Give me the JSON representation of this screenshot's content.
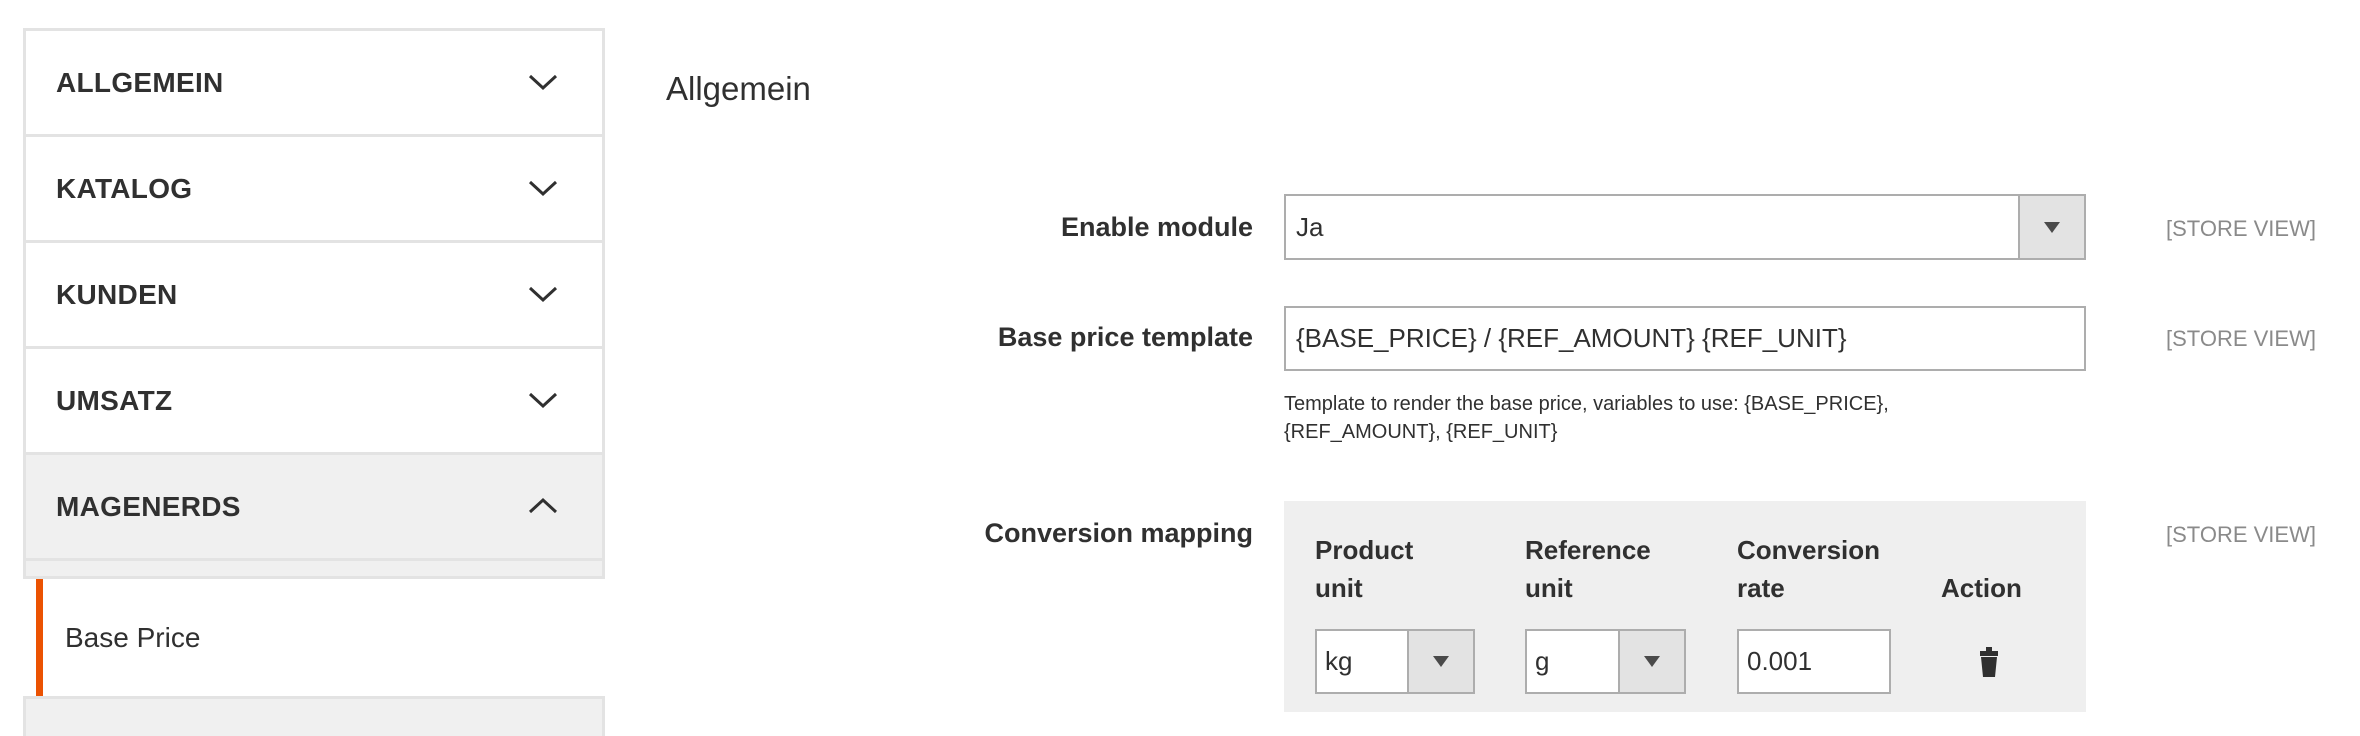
{
  "sidebar": {
    "sections": [
      {
        "label": "ALLGEMEIN",
        "expanded": false
      },
      {
        "label": "KATALOG",
        "expanded": false
      },
      {
        "label": "KUNDEN",
        "expanded": false
      },
      {
        "label": "UMSATZ",
        "expanded": false
      },
      {
        "label": "MAGENERDS",
        "expanded": true
      }
    ],
    "active_item": "Base Price"
  },
  "main": {
    "title": "Allgemein",
    "enable_module": {
      "label": "Enable module",
      "value": "Ja",
      "scope": "[STORE VIEW]"
    },
    "base_price_template": {
      "label": "Base price template",
      "value": "{BASE_PRICE} / {REF_AMOUNT} {REF_UNIT}",
      "note_line1": "Template to render the base price, variables to use: {BASE_PRICE},",
      "note_line2": "{REF_AMOUNT}, {REF_UNIT}",
      "scope": "[STORE VIEW]"
    },
    "conversion_mapping": {
      "label": "Conversion mapping",
      "scope": "[STORE VIEW]",
      "headers": {
        "product_unit_1": "Product",
        "product_unit_2": "unit",
        "reference_unit_1": "Reference",
        "reference_unit_2": "unit",
        "rate_1": "Conversion",
        "rate_2": "rate",
        "action": "Action"
      },
      "rows": [
        {
          "product_unit": "kg",
          "reference_unit": "g",
          "rate": "0.001"
        }
      ]
    }
  },
  "colors": {
    "accent": "#eb5202"
  }
}
